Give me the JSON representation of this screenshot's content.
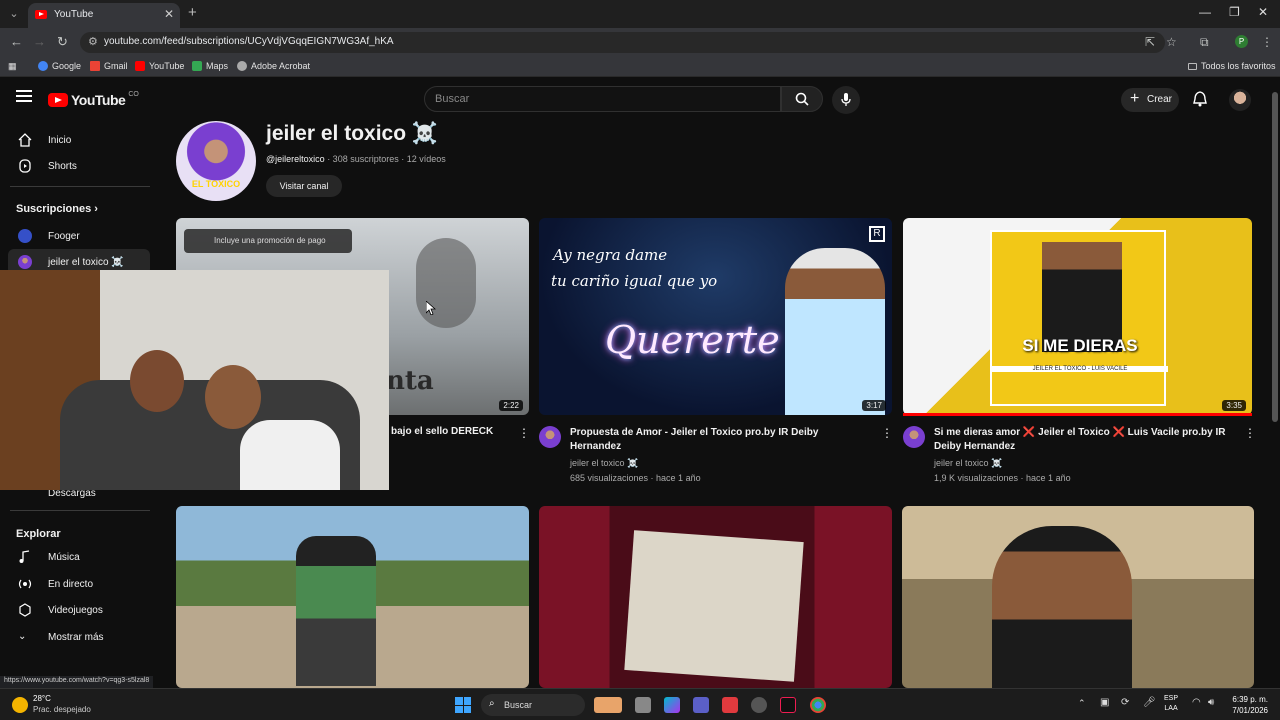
{
  "browser": {
    "tab_title": "YouTube",
    "url": "youtube.com/feed/subscriptions/UCyVdjVGqqEIGN7WG3Af_hKA",
    "bookmarks": [
      "Google",
      "Gmail",
      "YouTube",
      "Maps",
      "Adobe Acrobat"
    ],
    "bookmarks_right": "Todos los favoritos",
    "profile_initial": "P"
  },
  "header": {
    "logo": "YouTube",
    "country": "CO",
    "search_placeholder": "Buscar",
    "create_label": "Crear"
  },
  "sidebar": {
    "items": [
      {
        "label": "Inicio",
        "icon": "home-icon"
      },
      {
        "label": "Shorts",
        "icon": "shorts-icon"
      }
    ],
    "subscriptions_header": "Suscripciones",
    "subscriptions": [
      "Fooger",
      "jeiler el toxico ☠️"
    ],
    "downloads": "Descargas",
    "explore_header": "Explorar",
    "explore": [
      "Música",
      "En directo",
      "Videojuegos",
      "Mostrar más"
    ]
  },
  "channel": {
    "name": "jeiler el toxico ☠️",
    "handle": "@jeilereltoxico",
    "meta": "· 308 suscriptores · 12 vídeos",
    "avatar_text": "EL TOXICO",
    "visit_label": "Visitar canal"
  },
  "videos": [
    {
      "title": "bajo el sello DERECK",
      "duration": "2:22",
      "promo": "Incluye una promoción de pago",
      "thumb_text": "nta"
    },
    {
      "title": "Propuesta de Amor - Jeiler el Toxico pro.by IR Deiby Hernandez",
      "channel": "jeiler el toxico ☠️",
      "stats": "685 visualizaciones · hace 1 año",
      "duration": "3:17",
      "thumb_line1": "Ay negra dame",
      "thumb_line2": "tu cariño igual que yo",
      "thumb_big": "Quererte"
    },
    {
      "title": "Si me dieras amor ❌ Jeiler el Toxico ❌ Luis Vacile pro.by IR Deiby Hernandez",
      "channel": "jeiler el toxico ☠️",
      "stats": "1,9 K visualizaciones · hace 1 año",
      "duration": "3:35",
      "thumb_big": "SI ME DIERAS",
      "thumb_sub": "JEILER EL TOXICO - LUIS VACILE"
    }
  ],
  "status_url": "https://www.youtube.com/watch?v=qg3-s5lzal8",
  "taskbar": {
    "weather_temp": "28°C",
    "weather_desc": "Prac. despejado",
    "search": "Buscar",
    "lang": "ESP",
    "lang2": "LAA",
    "time": "6:39 p. m.",
    "date": "7/01/2026"
  },
  "colors": {
    "background": "#0f0f0f",
    "brand_red": "#ff0000",
    "text_secondary": "#aaaaaa"
  }
}
